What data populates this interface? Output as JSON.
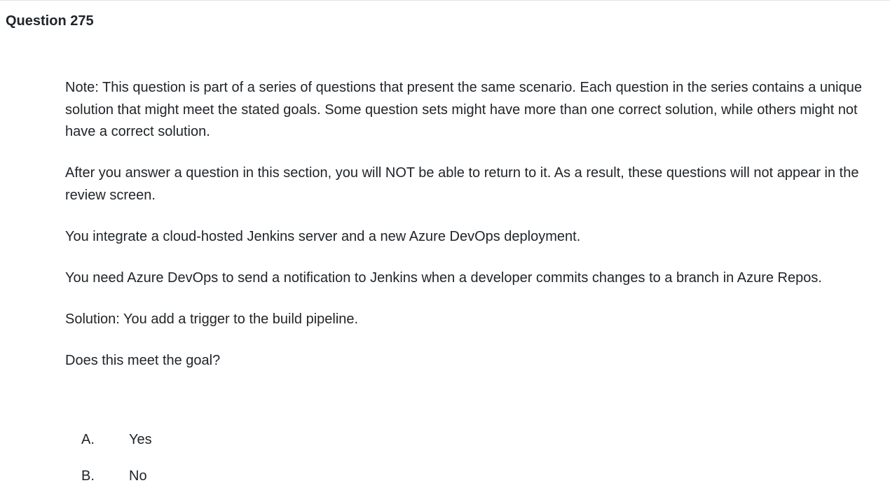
{
  "question": {
    "title": "Question 275",
    "paragraphs": [
      "Note: This question is part of a series of questions that present the same scenario. Each question in the series contains a unique solution that might meet the stated goals. Some question sets might have more than one correct solution, while others might not have a correct solution.",
      "After you answer a question in this section, you will NOT be able to return to it. As a result, these questions will not appear in the review screen.",
      "You integrate a cloud-hosted Jenkins server and a new Azure DevOps deployment.",
      "You need Azure DevOps to send a notification to Jenkins when a developer commits changes to a branch in Azure Repos.",
      "Solution: You add a trigger to the build pipeline.",
      "Does this meet the goal?"
    ],
    "choices": [
      {
        "letter": "A.",
        "text": "Yes"
      },
      {
        "letter": "B.",
        "text": "No"
      }
    ]
  }
}
